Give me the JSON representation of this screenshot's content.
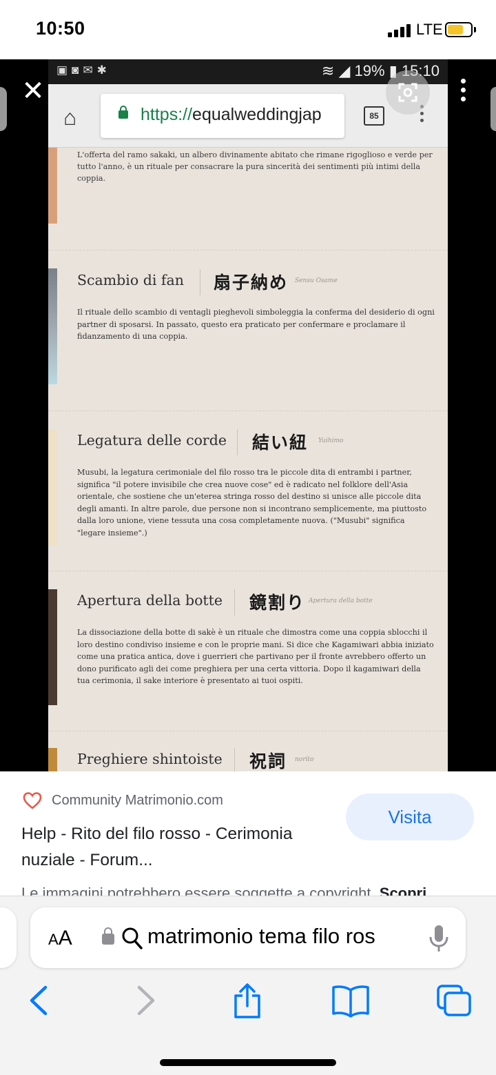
{
  "ios_status": {
    "time": "10:50",
    "network": "LTE"
  },
  "android_status": {
    "battery": "19%",
    "time": "15:10"
  },
  "browser": {
    "url_scheme": "https://",
    "url_host": "equalweddingjap",
    "tab_count": "85"
  },
  "page": {
    "intro": "L'offerta del ramo sakaki, un albero divinamente abitato che rimane rigoglioso e verde per tutto l'anno, è un rituale per consacrare la pura sincerità dei sentimenti più intimi della coppia.",
    "sections": [
      {
        "title": "Scambio di fan",
        "kanji": "扇子納め",
        "romaji": "Sensu Osame",
        "body": "Il rituale dello scambio di ventagli pieghevoli simboleggia la conferma del desiderio di ogni partner di sposarsi. In passato, questo era praticato per confermare e proclamare il fidanzamento di una coppia."
      },
      {
        "title": "Legatura delle corde",
        "kanji": "結い紐",
        "romaji": "Yuihimo",
        "body": "Musubi, la legatura cerimoniale del filo rosso tra le piccole dita di entrambi i partner, significa \"il potere invisibile che crea nuove cose\" ed è radicato nel folklore dell'Asia orientale, che sostiene che un'eterea stringa rosso del destino si unisce alle piccole dita degli amanti. In altre parole, due persone non si incontrano semplicemente, ma piuttosto dalla loro unione, viene tessuta una cosa completamente nuova. (\"Musubi\" significa \"legare insieme\".)"
      },
      {
        "title": "Apertura della botte",
        "kanji": "鏡割り",
        "romaji": "Apertura della botte",
        "body": "La dissociazione della botte di sakè è un rituale che dimostra come una coppia sblocchi il loro destino condiviso insieme e con le proprie mani. Si dice che Kagamiwari abbia iniziato come una pratica antica, dove i guerrieri che partivano per il fronte avrebbero offerto un dono purificato agli dei come preghiera per una certa vittoria. Dopo il kagamiwari della tua cerimonia, il sake interiore è presentato ai tuoi ospiti."
      },
      {
        "title": "Preghiere shintoiste",
        "kanji": "祝詞",
        "romaji": "norito",
        "body": ""
      }
    ]
  },
  "result": {
    "source": "Community Matrimonio.com",
    "visit_label": "Visita",
    "title": "Help - Rito del filo rosso - Cerimonia nuziale - Forum...",
    "copyright": "Le immagini potrebbero essere soggette a copyright.",
    "copyright_link": "Scopri"
  },
  "safari": {
    "aa_label": "AA",
    "address_text": "matrimonio tema filo ros"
  },
  "colors": {
    "accent": "#1a73e8",
    "visit_bg": "#e8f0fe",
    "heart": "#e8594c",
    "battery": "#f6c428",
    "lock_green": "#19804a"
  }
}
